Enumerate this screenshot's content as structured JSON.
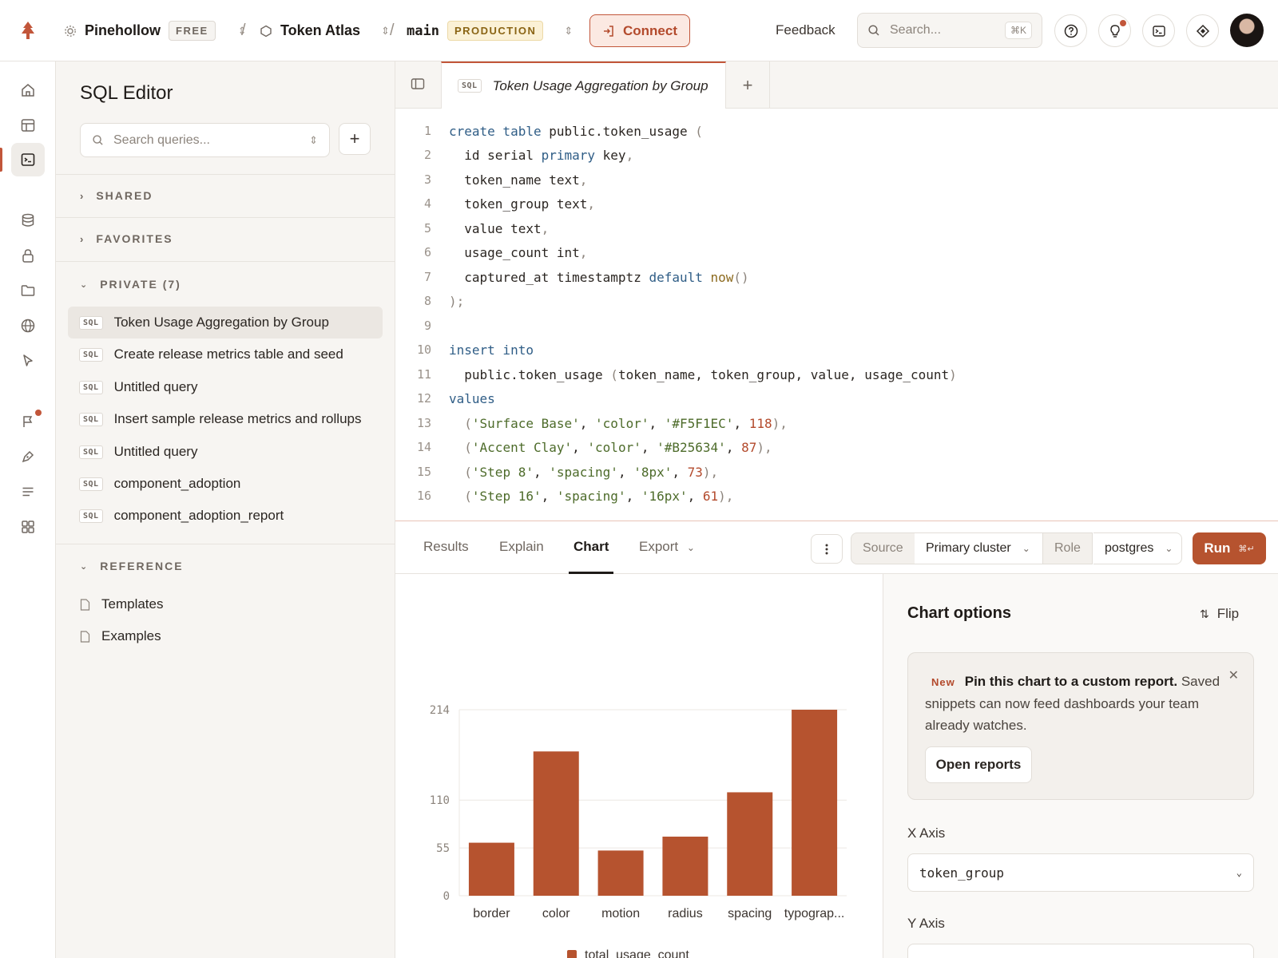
{
  "topbar": {
    "org_name": "Pinehollow",
    "org_plan": "FREE",
    "project_name": "Token Atlas",
    "branch": "main",
    "branch_env": "PRODUCTION",
    "connect_label": "Connect",
    "feedback_label": "Feedback",
    "search_placeholder": "Search...",
    "search_shortcut": "⌘K"
  },
  "sidebar": {
    "title": "SQL Editor",
    "search_placeholder": "Search queries...",
    "sections": {
      "shared": "SHARED",
      "favorites": "FAVORITES",
      "private": "PRIVATE (7)",
      "reference": "REFERENCE"
    },
    "queries": [
      {
        "tag": "SQL",
        "label": "Token Usage Aggregation by Group"
      },
      {
        "tag": "SQL",
        "label": "Create release metrics table and seed"
      },
      {
        "tag": "SQL",
        "label": "Untitled query"
      },
      {
        "tag": "SQL",
        "label": "Insert sample release metrics and rollups"
      },
      {
        "tag": "SQL",
        "label": "Untitled query"
      },
      {
        "tag": "SQL",
        "label": "component_adoption"
      },
      {
        "tag": "SQL",
        "label": "component_adoption_report"
      }
    ],
    "reference_items": [
      "Templates",
      "Examples"
    ]
  },
  "editor": {
    "tab_tag": "SQL",
    "tab_title": "Token Usage Aggregation by Group",
    "line_numbers": [
      "1",
      "2",
      "3",
      "4",
      "5",
      "6",
      "7",
      "8",
      "9",
      "10",
      "11",
      "12",
      "13",
      "14",
      "15",
      "16"
    ],
    "code": {
      "l1": [
        "create table",
        " public.token_usage ",
        "("
      ],
      "l2": [
        "  id serial ",
        "primary",
        " key",
        ","
      ],
      "l3": [
        "  token_name text",
        ","
      ],
      "l4": [
        "  token_group text",
        ","
      ],
      "l5": [
        "  value text",
        ","
      ],
      "l6": [
        "  usage_count int",
        ","
      ],
      "l7": [
        "  captured_at timestamptz ",
        "default",
        " now",
        "()"
      ],
      "l8": [
        ");"
      ],
      "l10": [
        "insert into"
      ],
      "l11": [
        "  public.token_usage ",
        "(",
        "token_name, token_group, value, usage_count",
        ")"
      ],
      "l12": [
        "values"
      ],
      "l13": [
        "  (",
        "'Surface Base'",
        ", ",
        "'color'",
        ", ",
        "'#F5F1EC'",
        ", ",
        "118",
        "),"
      ],
      "l14": [
        "  (",
        "'Accent Clay'",
        ", ",
        "'color'",
        ", ",
        "'#B25634'",
        ", ",
        "87",
        "),"
      ],
      "l15": [
        "  (",
        "'Step 8'",
        ", ",
        "'spacing'",
        ", ",
        "'8px'",
        ", ",
        "73",
        "),"
      ],
      "l16": [
        "  (",
        "'Step 16'",
        ", ",
        "'spacing'",
        ", ",
        "'16px'",
        ", ",
        "61",
        "),"
      ]
    }
  },
  "results": {
    "tabs": [
      "Results",
      "Explain",
      "Chart",
      "Export"
    ],
    "active_tab": "Chart",
    "source_label": "Source",
    "source_value": "Primary cluster",
    "role_label": "Role",
    "role_value": "postgres",
    "run_label": "Run",
    "run_shortcut": "⌘↵"
  },
  "chart_options": {
    "title": "Chart options",
    "flip_label": "Flip",
    "promo_badge": "New",
    "promo_heading": "Pin this chart to a custom report.",
    "promo_body": "Saved snippets can now feed dashboards your team already watches.",
    "promo_button": "Open reports",
    "x_axis_label": "X Axis",
    "x_axis_value": "token_group",
    "y_axis_label": "Y Axis"
  },
  "chart_data": {
    "type": "bar",
    "categories": [
      "border",
      "color",
      "motion",
      "radius",
      "spacing",
      "typograp..."
    ],
    "values": [
      61,
      166,
      52,
      68,
      119,
      214
    ],
    "yticks": [
      0,
      55,
      110,
      214
    ],
    "ylim": [
      0,
      214
    ],
    "series_name": "total_usage_count",
    "bar_color": "#b6532f"
  },
  "colors": {
    "accent": "#c2563a",
    "run_button": "#b6532f",
    "production_badge": "#8a6414"
  }
}
